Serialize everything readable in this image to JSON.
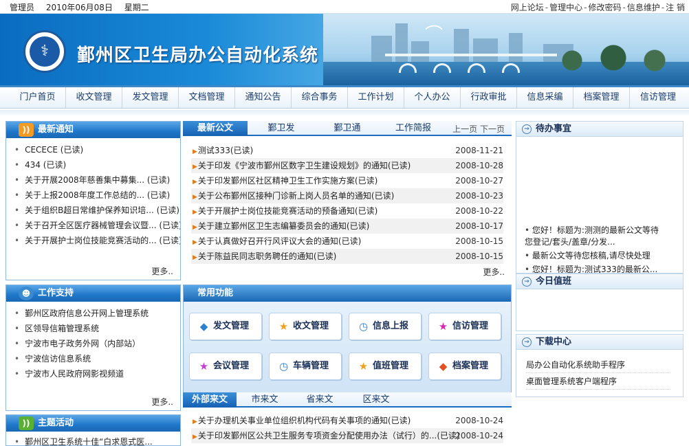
{
  "topbar": {
    "user": "管理员",
    "date": "2010年06月08日",
    "weekday": "星期二",
    "links": [
      "网上论坛",
      "管理中心",
      "修改密码",
      "信息维护",
      "注 销"
    ]
  },
  "banner": {
    "title": "鄞州区卫生局办公自动化系统"
  },
  "nav": [
    "门户首页",
    "收文管理",
    "发文管理",
    "文档管理",
    "通知公告",
    "综合事务",
    "工作计划",
    "个人办公",
    "行政审批",
    "信息采编",
    "档案管理",
    "信访管理"
  ],
  "latest_notice": {
    "title": "最新通知",
    "items": [
      "CECECE (已读)",
      "434 (已读)",
      "关于开展2008年慈善集中募集... (已读)",
      "关于上报2008年度工作总结的... (已读)",
      "关于组织B超日常维护保养知识培... (已读)",
      "关于召开全区医疗器械管理会议暨... (已读)",
      "关于开展护士岗位技能竞赛活动的... (已读)"
    ],
    "more": "更多.."
  },
  "work_support": {
    "title": "工作支持",
    "items": [
      "鄞州区政府信息公开网上管理系统",
      "区领导信箱管理系统",
      "宁波市电子政务外网（内部站）",
      "宁波信访信息系统",
      "宁波市人民政府网影视频道"
    ],
    "more": "更多.."
  },
  "theme_activity": {
    "title": "主题活动",
    "items": [
      "鄞州区卫生系统十佳“白求恩式医..."
    ]
  },
  "latest_docs": {
    "tabs": [
      "最新公文",
      "鄞卫发",
      "鄞卫通",
      "工作简报"
    ],
    "pager": "上一页 下一页",
    "items": [
      {
        "title": "测试333(已读)",
        "date": "2008-11-21"
      },
      {
        "title": "关于印发《宁波市鄞州区数字卫生建设规划》的通知(已读)",
        "date": "2008-10-28"
      },
      {
        "title": "关于印发鄞州区社区精神卫生工作实施方案(已读)",
        "date": "2008-10-27"
      },
      {
        "title": "关于公布鄞州区接种门诊新上岗人员名单的通知(已读)",
        "date": "2008-10-23"
      },
      {
        "title": "关于开展护士岗位技能竞赛活动的预备通知(已读)",
        "date": "2008-10-22"
      },
      {
        "title": "关于建立鄞州区卫生志编纂委员会的通知(已读)",
        "date": "2008-10-17"
      },
      {
        "title": "关于认真做好召开行风评议大会的通知(已读)",
        "date": "2008-10-15"
      },
      {
        "title": "关于陈益民同志职务聘任的通知(已读)",
        "date": "2008-10-15"
      }
    ],
    "more": "更多.."
  },
  "functions": {
    "title": "常用功能",
    "buttons": [
      {
        "label": "发文管理",
        "icon": "cube-icon",
        "color": "#2a7fd0"
      },
      {
        "label": "收文管理",
        "icon": "star-icon",
        "color": "#f0a020"
      },
      {
        "label": "信息上报",
        "icon": "clock-icon",
        "color": "#2a7fd0"
      },
      {
        "label": "信访管理",
        "icon": "star-icon",
        "color": "#d02ab0"
      },
      {
        "label": "会议管理",
        "icon": "star-icon",
        "color": "#c040d0"
      },
      {
        "label": "车辆管理",
        "icon": "clock-icon",
        "color": "#2a7fd0"
      },
      {
        "label": "值班管理",
        "icon": "star-icon",
        "color": "#f0a020"
      },
      {
        "label": "档案管理",
        "icon": "cube-icon",
        "color": "#e05020"
      }
    ]
  },
  "external_docs": {
    "tabs": [
      "外部来文",
      "市来文",
      "省来文",
      "区来文"
    ],
    "items": [
      {
        "title": "关于办理机关事业单位组织机构代码有关事项的通知(已读)",
        "date": "2008-10-24"
      },
      {
        "title": "关于印发鄞州区公共卫生服务专项资金分配使用办法（试行）的...(已读)",
        "date": "2008-10-24"
      }
    ]
  },
  "todo": {
    "title": "待办事宜",
    "items": [
      "您好！标题为:测测的最新公文等待您登记/套头/盖章/分发...",
      "最新公文等待您核稿,请尽快处理",
      "您好！标题为:测试333的最新公..."
    ]
  },
  "duty": {
    "title": "今日值班"
  },
  "download": {
    "title": "下载中心",
    "items": [
      "局办公自动化系统助手程序",
      "桌面管理系统客户端程序"
    ]
  }
}
